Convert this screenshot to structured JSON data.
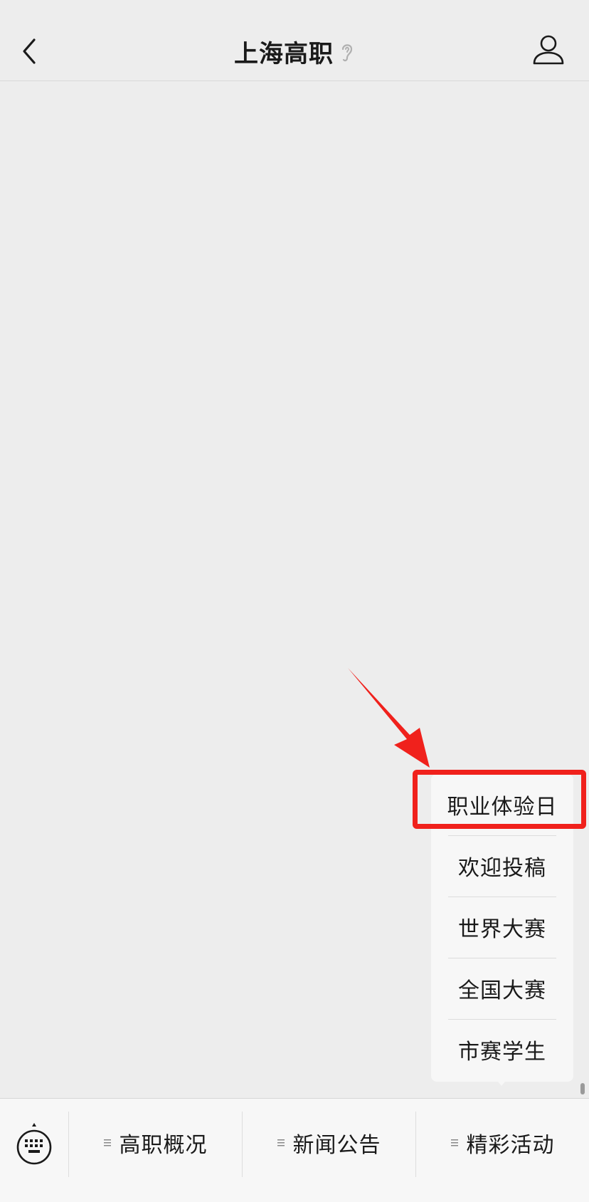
{
  "header": {
    "title": "上海高职"
  },
  "popup_menu": {
    "items": [
      {
        "label": "职业体验日"
      },
      {
        "label": "欢迎投稿"
      },
      {
        "label": "世界大赛"
      },
      {
        "label": "全国大赛"
      },
      {
        "label": "市赛学生"
      }
    ]
  },
  "bottom_menu": {
    "items": [
      {
        "label": "高职概况"
      },
      {
        "label": "新闻公告"
      },
      {
        "label": "精彩活动"
      }
    ]
  },
  "colors": {
    "background": "#ededed",
    "annotation_red": "#f0211c",
    "popup_bg": "#f7f7f7"
  },
  "icons": [
    "chevron-left-icon",
    "ear-icon",
    "user-icon",
    "keyboard-icon",
    "menu-lines-icon"
  ]
}
